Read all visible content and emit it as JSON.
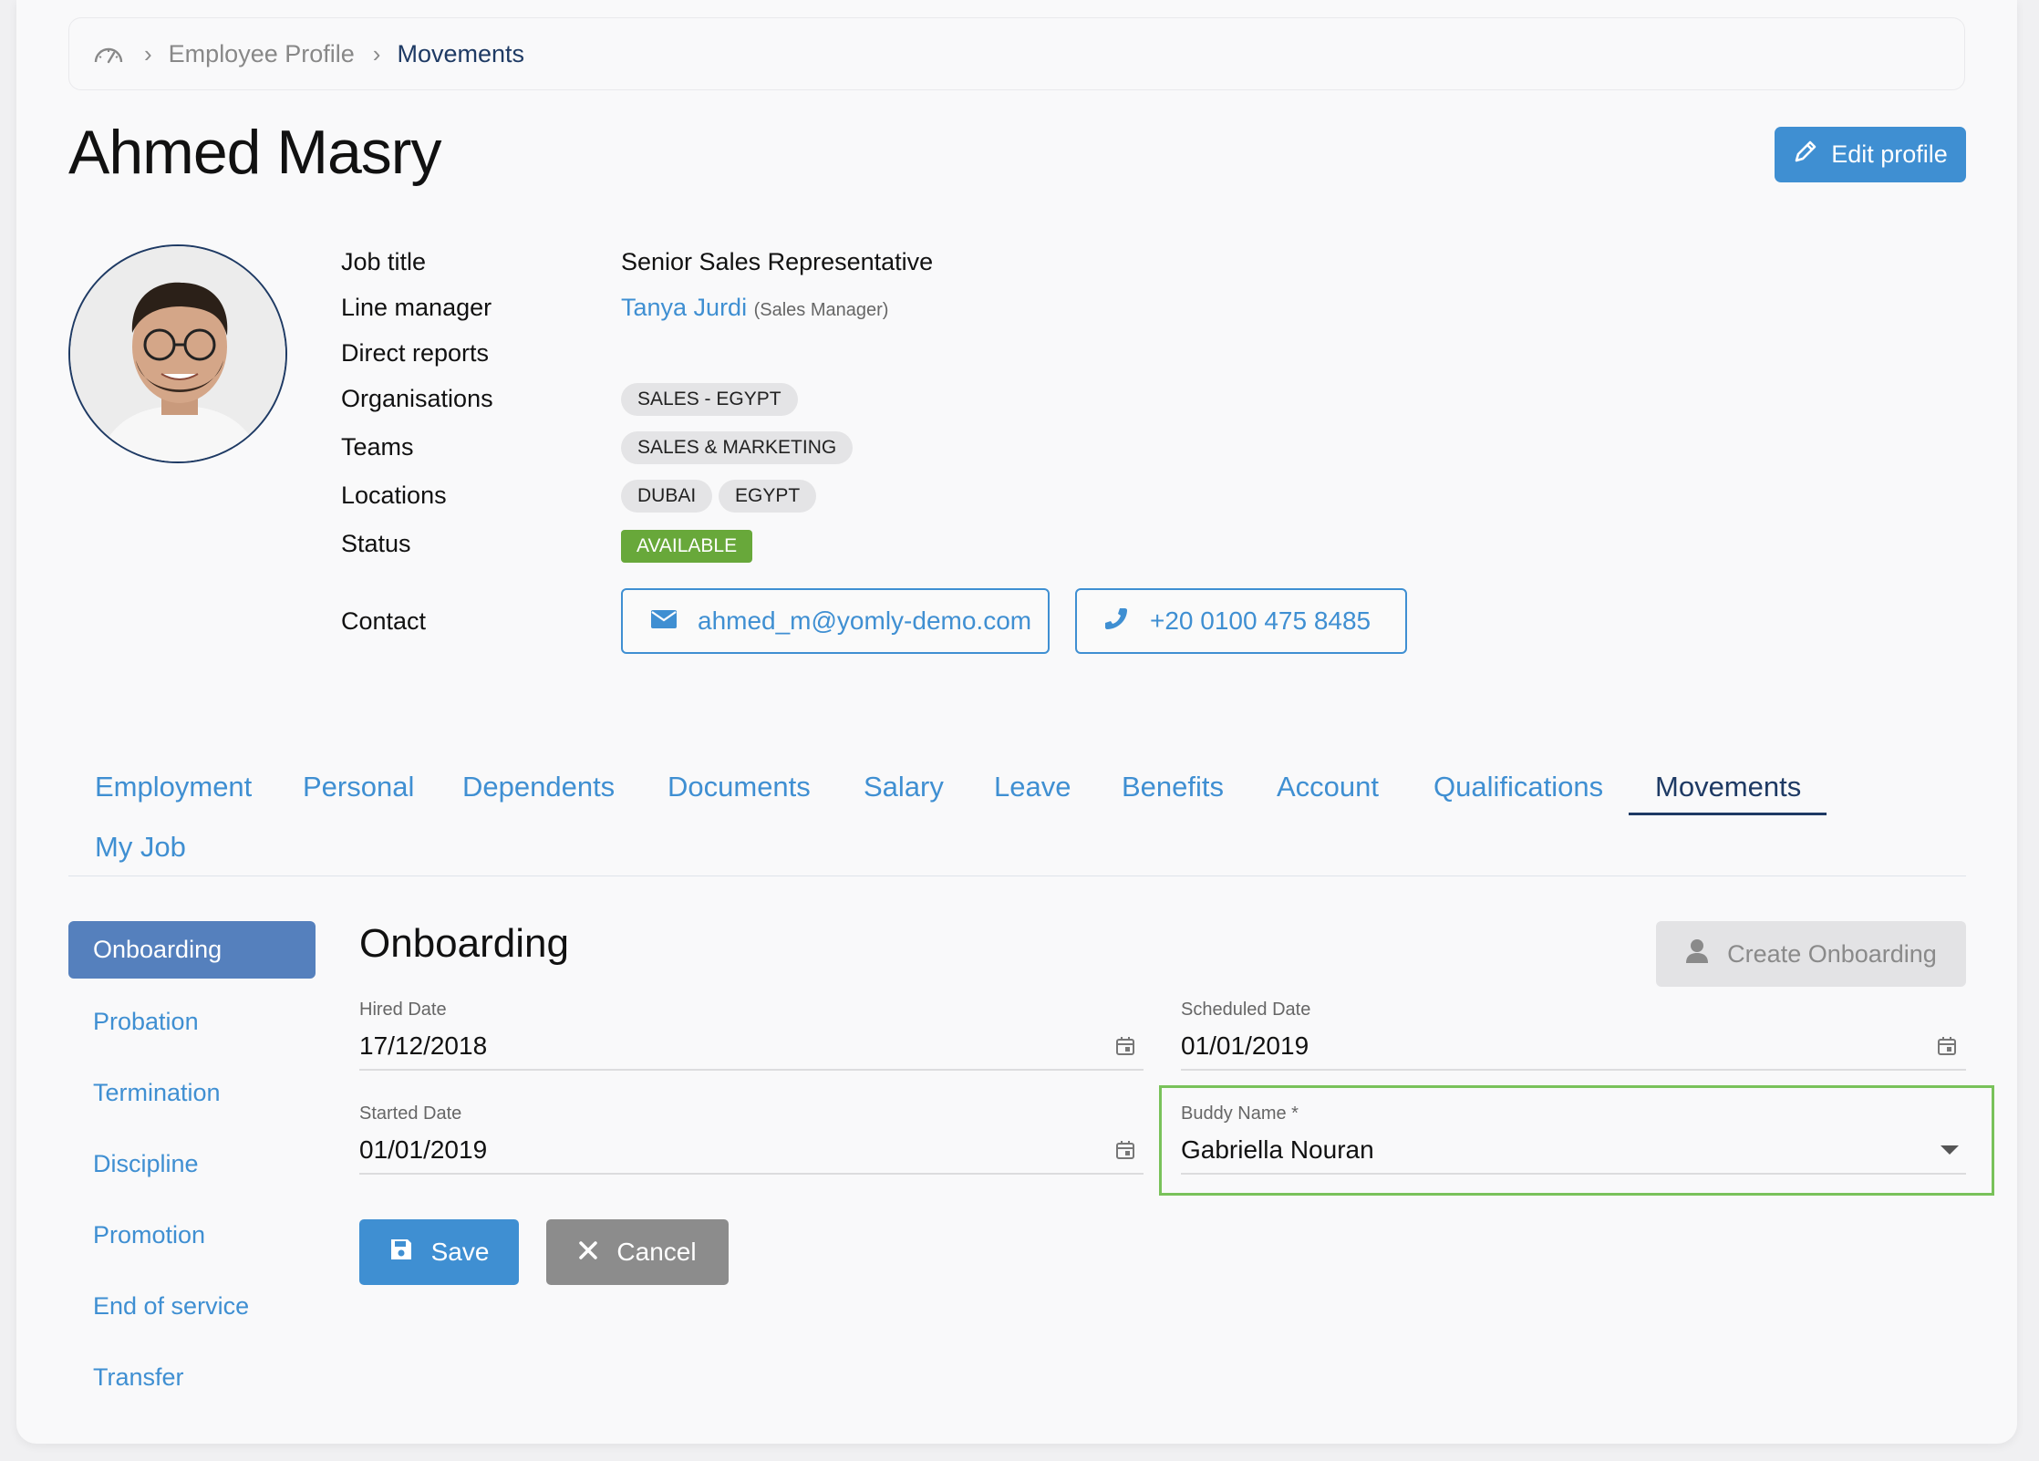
{
  "breadcrumb": {
    "home_icon": "dashboard-gauge-icon",
    "items": [
      {
        "label": "Employee Profile"
      },
      {
        "label": "Movements"
      }
    ]
  },
  "employee": {
    "name": "Ahmed Masry",
    "edit_label": "Edit profile"
  },
  "details": {
    "job_title_label": "Job title",
    "job_title": "Senior Sales Representative",
    "line_manager_label": "Line manager",
    "line_manager": "Tanya Jurdi",
    "line_manager_role": "(Sales Manager)",
    "direct_reports_label": "Direct reports",
    "organisations_label": "Organisations",
    "organisations": [
      "SALES - EGYPT"
    ],
    "teams_label": "Teams",
    "teams": [
      "SALES & MARKETING"
    ],
    "locations_label": "Locations",
    "locations": [
      "DUBAI",
      "EGYPT"
    ],
    "status_label": "Status",
    "status": "AVAILABLE",
    "contact_label": "Contact",
    "email": "ahmed_m@yomly-demo.com",
    "phone": "+20 0100 475 8485"
  },
  "tabs": [
    {
      "label": "Employment"
    },
    {
      "label": "Personal"
    },
    {
      "label": "Dependents"
    },
    {
      "label": "Documents"
    },
    {
      "label": "Salary"
    },
    {
      "label": "Leave"
    },
    {
      "label": "Benefits"
    },
    {
      "label": "Account"
    },
    {
      "label": "Qualifications"
    },
    {
      "label": "Movements"
    },
    {
      "label": "My Job"
    }
  ],
  "active_tab": "Movements",
  "side_nav": [
    {
      "label": "Onboarding"
    },
    {
      "label": "Probation"
    },
    {
      "label": "Termination"
    },
    {
      "label": "Discipline"
    },
    {
      "label": "Promotion"
    },
    {
      "label": "End of service"
    },
    {
      "label": "Transfer"
    }
  ],
  "onboarding": {
    "title": "Onboarding",
    "create_label": "Create Onboarding",
    "hired_date_label": "Hired Date",
    "hired_date": "17/12/2018",
    "scheduled_date_label": "Scheduled Date",
    "scheduled_date": "01/01/2019",
    "started_date_label": "Started Date",
    "started_date": "01/01/2019",
    "buddy_label": "Buddy Name *",
    "buddy_name": "Gabriella Nouran",
    "save_label": "Save",
    "cancel_label": "Cancel"
  },
  "colors": {
    "accent": "#3f8fd2",
    "navy": "#1e3a64",
    "side_active": "#5580bd",
    "status_green": "#68a83a",
    "highlight": "#79c25a"
  }
}
